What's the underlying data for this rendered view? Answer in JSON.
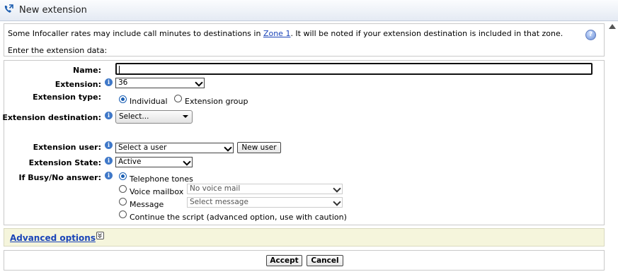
{
  "window": {
    "title": "New extension",
    "icon": "phone-transfer-icon"
  },
  "info": {
    "text_before": "Some Infocaller rates may include call minutes to destinations in ",
    "zone_link": "Zone 1",
    "text_after": ". It will be noted if your extension destination is included in that zone.",
    "enter_data": "Enter the extension data:",
    "help_icon": "?"
  },
  "form": {
    "name": {
      "label": "Name:",
      "value": ""
    },
    "extension": {
      "label": "Extension:",
      "value": "36"
    },
    "extension_type": {
      "label": "Extension type:",
      "options": [
        "Individual",
        "Extension group"
      ],
      "selected": "Individual"
    },
    "destination": {
      "label": "Extension destination:",
      "value": "Select..."
    },
    "user": {
      "label": "Extension user:",
      "value": "Select a user",
      "new_user_button": "New user"
    },
    "state": {
      "label": "Extension State:",
      "value": "Active"
    },
    "busy": {
      "label": "If Busy/No answer:",
      "options": [
        "Telephone tones",
        "Voice mailbox",
        "Message",
        "Continue the script (advanced option, use with caution)"
      ],
      "selected": "Telephone tones",
      "voice_mailbox_select": "No voice mail",
      "message_select": "Select message"
    }
  },
  "advanced": {
    "label": "Advanced options"
  },
  "actions": {
    "accept": "Accept",
    "cancel": "Cancel"
  },
  "colors": {
    "accent_blue": "#1a5fb4",
    "link": "#1a44b8",
    "advanced_bg": "#f5f5dc"
  }
}
